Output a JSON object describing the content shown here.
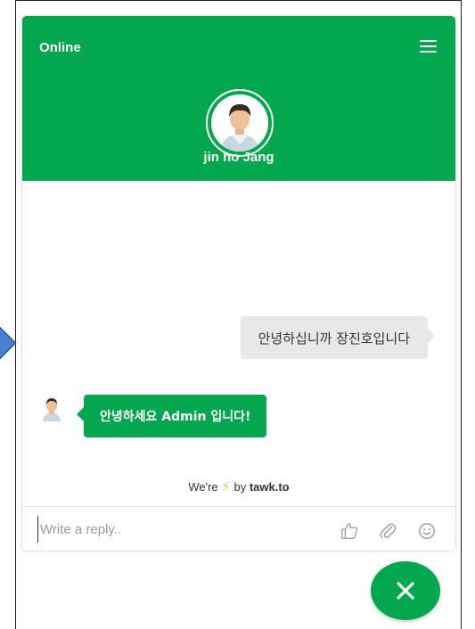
{
  "header": {
    "status": "Online",
    "agent_name": "jin ho Jang",
    "menu_icon": "hamburger-menu-icon"
  },
  "messages": [
    {
      "from": "visitor",
      "text": "안녕하십니까 장진호입니다"
    },
    {
      "from": "agent",
      "text": "안녕하세요 Admin 입니다!"
    }
  ],
  "branding": {
    "prefix": "We're",
    "suffix": "by",
    "name": "tawk.to",
    "icon": "lightning-bolt-icon"
  },
  "composer": {
    "placeholder": "Write a reply..",
    "value": ""
  },
  "colors": {
    "primary": "#03a84e",
    "visitor_bubble": "#e8e8e8",
    "side_arrow": "#4a7fd0"
  }
}
